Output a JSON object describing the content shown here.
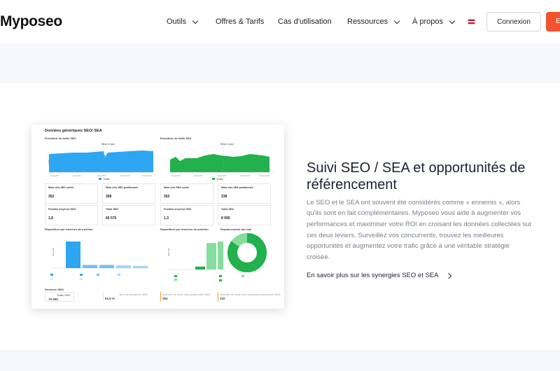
{
  "header": {
    "logo": "Myposeo",
    "nav": [
      {
        "label": "Outils",
        "has_dropdown": true
      },
      {
        "label": "Offres & Tarifs",
        "has_dropdown": false
      },
      {
        "label": "Cas d'utilisation",
        "has_dropdown": false
      },
      {
        "label": "Ressources",
        "has_dropdown": true
      },
      {
        "label": "À propos",
        "has_dropdown": true
      }
    ],
    "language_flag_icon": "uk-flag-icon",
    "login_label": "Connexion",
    "cta_label": "E",
    "cta_color": "#f2542d"
  },
  "dashboard": {
    "title": "Données génériques SEO/ SEA",
    "seo_chart": {
      "title": "Evolution du trafic SEO",
      "legend": "Trafic",
      "annotation": "Mise à jour",
      "color": "#2ea6f2",
      "ylabel": "Trafic"
    },
    "sea_chart": {
      "title": "Evolution du trafic SEA",
      "legend": "Trafic",
      "annotation": "Mise à jour",
      "color": "#22b14c",
      "ylabel": "Trafic"
    },
    "seo_metrics": [
      {
        "label": "Mots clés SEO suivis",
        "value": "352"
      },
      {
        "label": "Mots clés SEO positionnés",
        "value": "358"
      },
      {
        "label": "Position moyenne SEO",
        "value": "1,8"
      },
      {
        "label": "Trafic SEO",
        "value": "66 570"
      }
    ],
    "sea_metrics": [
      {
        "label": "Mots clés SEA suivis",
        "value": "352"
      },
      {
        "label": "Mots clés SEA positionnés",
        "value": "238"
      },
      {
        "label": "Position moyenne SEA",
        "value": "1,3"
      },
      {
        "label": "Trafic SEA",
        "value": "8 995"
      }
    ],
    "seo_distribution": {
      "title": "Répartition par tranches de position",
      "values": [
        100,
        12,
        12,
        10,
        8
      ],
      "color": "#2ea6f2",
      "light_color": "#9fd4f7"
    },
    "sea_distribution": {
      "title": "Répartition par tranches de position",
      "values": [
        10,
        90,
        95
      ],
      "color": "#22b14c",
      "light_color": "#86dd9c"
    },
    "ad_placement": {
      "title": "Emplacements des ads",
      "color": "#22b14c",
      "light_color": "#86dd9c",
      "share_primary": 0.85
    },
    "footer_metrics": [
      {
        "label": "Données SEM",
        "value": ""
      },
      {
        "label": "Trafic SEA",
        "value": "75 565"
      },
      {
        "label": "Taux de présence SEA",
        "value": "61,9 %"
      },
      {
        "label": "Nombre de mots clés positionnés SEA",
        "value": "384"
      },
      {
        "label": "Nombre de mots clés communs positionnés SEA",
        "value": "232"
      }
    ]
  },
  "content": {
    "heading": "Suivi SEO / SEA et opportunités de référencement",
    "body": "Le SEO et le SEA ont souvent été considérés comme « ennemis », alors qu'ils sont en fait complémentaires. Myposeo vous aide à augmenter vos performances et maximiser votre ROI en croisant les données collectées sur ces deux leviers. Surveillez vos concurrents, trouvez les meilleures opportunités et augmentez votre trafic grâce à une véritable stratégie croisée.",
    "link_label": "En savoir plus sur les synergies SEO et SEA",
    "link_icon": "chevron-right-icon"
  }
}
